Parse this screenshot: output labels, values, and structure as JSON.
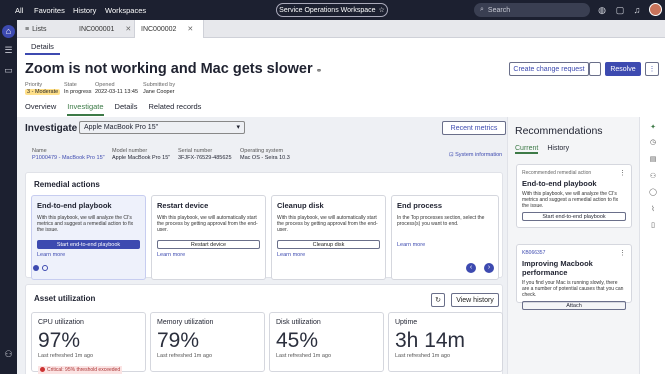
{
  "topnav": {
    "all": "All",
    "favorites": "Favorites",
    "history": "History",
    "workspaces": "Workspaces",
    "workspace_title": "Service Operations Workspace",
    "search_placeholder": "Search"
  },
  "tabs": {
    "lists": "Lists",
    "tab1": "INC000001",
    "tab2": "INC000002"
  },
  "subtab": "Details",
  "record": {
    "title": "Zoom is not working and Mac gets slower",
    "create_change": "Create change request",
    "resolve": "Resolve",
    "meta": [
      {
        "label": "Priority",
        "value": "3 - Moderate"
      },
      {
        "label": "State",
        "value": "In progress"
      },
      {
        "label": "Opened",
        "value": "2022-03-11 13:45"
      },
      {
        "label": "Submitted by",
        "value": "Jane Cooper"
      }
    ]
  },
  "pagetabs": [
    "Overview",
    "Investigate",
    "Details",
    "Related records"
  ],
  "investigate": {
    "title": "Investigate",
    "device": "Apple MacBook Pro 15\"",
    "recent_metrics": "Recent metrics",
    "fields": [
      {
        "label": "Name",
        "value": "P1000479 - MacBook Pro 15\""
      },
      {
        "label": "Model number",
        "value": "Apple MacBook Pro 15\""
      },
      {
        "label": "Serial number",
        "value": "3FJFX-76529-485625"
      },
      {
        "label": "Operating system",
        "value": "Mac OS - Seira 10.3"
      }
    ],
    "system_info": "System information"
  },
  "remedial": {
    "title": "Remedial actions",
    "cards": [
      {
        "title": "End-to-end playbook",
        "desc": "With this playbook, we will analyze the CI's metrics and suggest a remedial action to fix the issue.",
        "button": "Start end-to-end playbook",
        "learn": "Learn more"
      },
      {
        "title": "Restart device",
        "desc": "With this playbook, we will automatically start the process by getting approval from the end-user.",
        "button": "Restart device",
        "learn": "Learn more"
      },
      {
        "title": "Cleanup disk",
        "desc": "With this playbook, we will automatically start the process by getting approval from the end-user.",
        "button": "Cleanup disk",
        "learn": "Learn more"
      },
      {
        "title": "End process",
        "desc": "In the Top processes section, select the process(s) you want to end.",
        "button": "",
        "learn": "Learn more"
      }
    ]
  },
  "asset": {
    "title": "Asset utilization",
    "view_history": "View history",
    "metrics": [
      {
        "label": "CPU utilization",
        "value": "97%",
        "refreshed": "Last refreshed 1m ago",
        "critical": "Critical: 95% threshold exceeded"
      },
      {
        "label": "Memory utilization",
        "value": "79%",
        "refreshed": "Last refreshed 1m ago"
      },
      {
        "label": "Disk utilization",
        "value": "45%",
        "refreshed": "Last refreshed 1m ago"
      },
      {
        "label": "Uptime",
        "value": "3h 14m",
        "refreshed": "Last refreshed 1m ago"
      }
    ]
  },
  "recommendations": {
    "title": "Recommendations",
    "tabs": [
      "Current",
      "History"
    ],
    "cards": [
      {
        "kicker": "Recommended remedial action",
        "title": "End-to-end playbook",
        "desc": "With this playbook, we will analyze the CI's metrics and suggest a remedial action to fix the issue.",
        "button": "Start end-to-end playbook"
      },
      {
        "kicker": "KB066357",
        "title": "Improving Macbook performance",
        "desc": "If you find your Mac is running slowly, there are a number of potential causes that you can check.",
        "button": "Attach"
      }
    ]
  },
  "colors": {
    "accent": "#3d4ab0",
    "active_tab": "#3d7a47",
    "critical": "#cc3333"
  }
}
